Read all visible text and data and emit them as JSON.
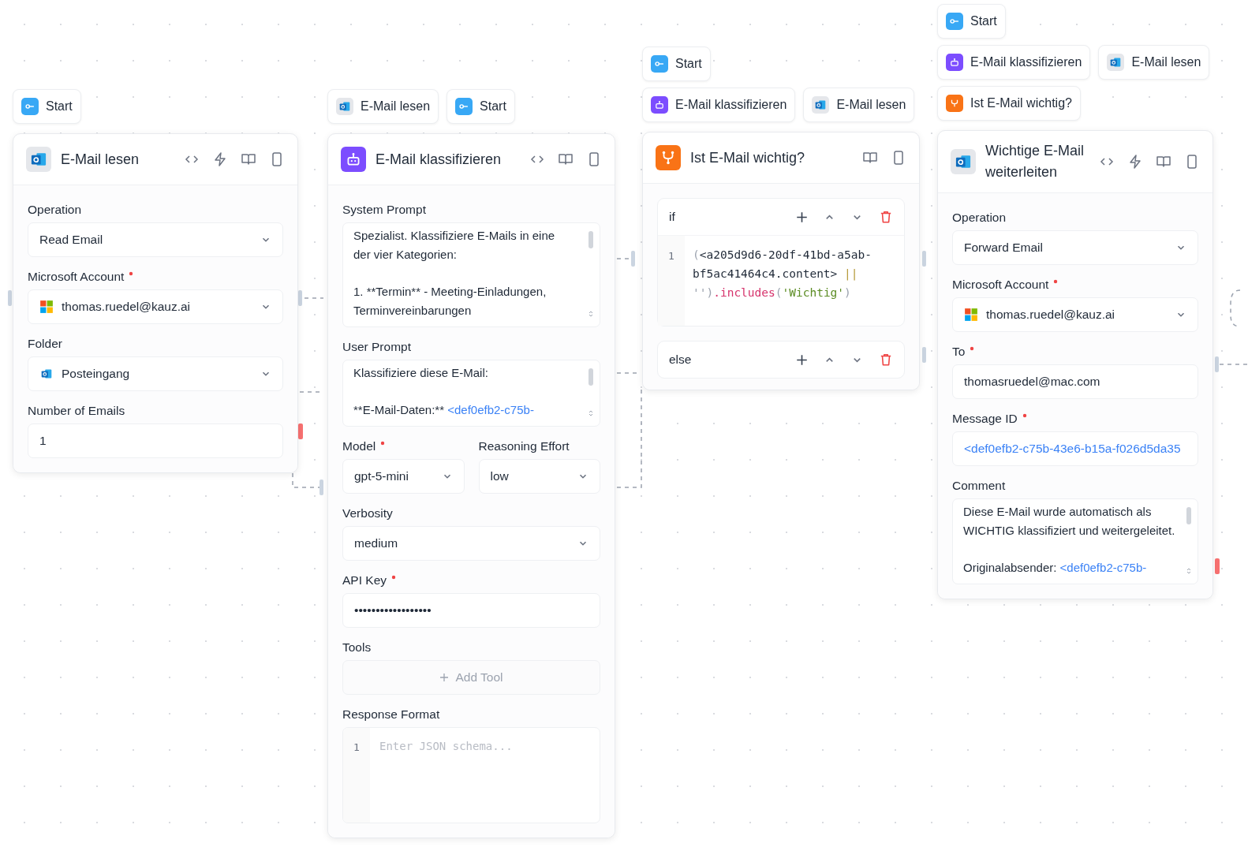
{
  "nodes": [
    {
      "inputs": [
        [
          {
            "label": "Start",
            "kind": "start"
          }
        ]
      ],
      "title": [
        "E-Mail lesen"
      ],
      "kind": "outlook",
      "actions": [
        {
          "kind": "code"
        },
        {
          "kind": "bolt"
        },
        {
          "kind": "book"
        },
        {
          "kind": "panel"
        }
      ],
      "fields": [
        {
          "kind": "select",
          "label": "Operation",
          "required": false,
          "value": "Read Email"
        },
        {
          "kind": "account",
          "label": "Microsoft Account",
          "required": true,
          "value": "thomas.ruedel@kauz.ai"
        },
        {
          "kind": "folder",
          "label": "Folder",
          "required": false,
          "value": "Posteingang"
        },
        {
          "kind": "input",
          "label": "Number of Emails",
          "required": false,
          "value": "1",
          "ref": false
        }
      ]
    },
    {
      "inputs": [
        [
          {
            "label": "E-Mail lesen",
            "kind": "outlook"
          },
          {
            "label": "Start",
            "kind": "start"
          }
        ]
      ],
      "title": [
        "E-Mail klassifizieren"
      ],
      "kind": "robot",
      "actions": [
        {
          "kind": "code"
        },
        {
          "kind": "book"
        },
        {
          "kind": "panel"
        }
      ],
      "fields": [
        {
          "kind": "textarea",
          "label": "System Prompt",
          "required": false,
          "paragraphs": [
            [
              [
                {
                  "text": "Spezialist. Klassifiziere E-Mails in eine",
                  "ref": false
                }
              ],
              [
                {
                  "text": "der vier Kategorien:",
                  "ref": false
                }
              ]
            ],
            [
              [
                {
                  "text": "1. **Termin** - Meeting-Einladungen,",
                  "ref": false
                }
              ],
              [
                {
                  "text": "Terminvereinbarungen",
                  "ref": false
                }
              ]
            ]
          ]
        },
        {
          "kind": "textarea",
          "label": "User Prompt",
          "required": false,
          "paragraphs": [
            [
              [
                {
                  "text": "Klassifiziere diese E-Mail:",
                  "ref": false
                }
              ]
            ],
            [
              [
                {
                  "text": "**E-Mail-Daten:** ",
                  "ref": false
                },
                {
                  "text": "<def0efb2-c75b-",
                  "ref": true
                }
              ]
            ]
          ]
        },
        {
          "kind": "row",
          "fields": [
            {
              "kind": "select",
              "label": "Model",
              "required": true,
              "value": "gpt-5-mini"
            },
            {
              "kind": "select",
              "label": "Reasoning Effort",
              "required": false,
              "value": "low"
            }
          ]
        },
        {
          "kind": "select",
          "label": "Verbosity",
          "required": false,
          "value": "medium"
        },
        {
          "kind": "input",
          "label": "API Key",
          "required": true,
          "value": "••••••••••••••••••",
          "ref": false
        },
        {
          "kind": "add",
          "label": "Tools",
          "button": "Add Tool"
        },
        {
          "kind": "code",
          "label": "Response Format",
          "line_number": "1",
          "placeholder": "Enter JSON schema..."
        }
      ]
    },
    {
      "inputs": [
        [
          {
            "label": "Start",
            "kind": "start"
          }
        ],
        [
          {
            "label": "E-Mail klassifizieren",
            "kind": "robot"
          },
          {
            "label": "E-Mail lesen",
            "kind": "outlook"
          }
        ]
      ],
      "title": [
        "Ist E-Mail wichtig?"
      ],
      "kind": "branch",
      "actions": [
        {
          "kind": "book"
        },
        {
          "kind": "panel"
        }
      ],
      "branches": [
        {
          "label": "if",
          "line_number": "1",
          "code": [
            [
              {
                "text": "(",
                "kind": "punct"
              },
              {
                "text": "<a205d9d6-20df-41bd-a5ab-",
                "kind": "var"
              }
            ],
            [
              {
                "text": "bf5ac41464c4.content>",
                "kind": "var"
              },
              {
                "text": " ||",
                "kind": "op"
              }
            ],
            [
              {
                "text": "'')",
                "kind": "punct"
              },
              {
                "text": ".includes",
                "kind": "fn"
              },
              {
                "text": "(",
                "kind": "punct"
              },
              {
                "text": "'Wichtig'",
                "kind": "str"
              },
              {
                "text": ")",
                "kind": "punct"
              }
            ]
          ]
        },
        {
          "label": "else"
        }
      ]
    },
    {
      "inputs": [
        [
          {
            "label": "Start",
            "kind": "start"
          }
        ],
        [
          {
            "label": "E-Mail klassifizieren",
            "kind": "robot"
          },
          {
            "label": "E-Mail lesen",
            "kind": "outlook"
          }
        ],
        [
          {
            "label": "Ist E-Mail wichtig?",
            "kind": "branch"
          }
        ]
      ],
      "title": [
        "Wichtige E-Mail",
        "weiterleiten"
      ],
      "kind": "outlook",
      "actions": [
        {
          "kind": "code"
        },
        {
          "kind": "bolt"
        },
        {
          "kind": "book"
        },
        {
          "kind": "panel"
        }
      ],
      "fields": [
        {
          "kind": "select",
          "label": "Operation",
          "required": false,
          "value": "Forward Email"
        },
        {
          "kind": "account",
          "label": "Microsoft Account",
          "required": true,
          "value": "thomas.ruedel@kauz.ai"
        },
        {
          "kind": "input",
          "label": "To",
          "required": true,
          "value": "thomasruedel@mac.com",
          "ref": false
        },
        {
          "kind": "input",
          "label": "Message ID",
          "required": true,
          "value": "<def0efb2-c75b-43e6-b15a-f026d5da35",
          "ref": true
        },
        {
          "kind": "textarea",
          "label": "Comment",
          "required": false,
          "paragraphs": [
            [
              [
                {
                  "text": "Diese E-Mail wurde automatisch als",
                  "ref": false
                }
              ],
              [
                {
                  "text": "WICHTIG klassifiziert und weitergeleitet.",
                  "ref": false
                }
              ]
            ],
            [
              [
                {
                  "text": "Originalabsender: ",
                  "ref": false
                },
                {
                  "text": "<def0efb2-c75b-",
                  "ref": true
                }
              ]
            ]
          ]
        }
      ]
    }
  ]
}
